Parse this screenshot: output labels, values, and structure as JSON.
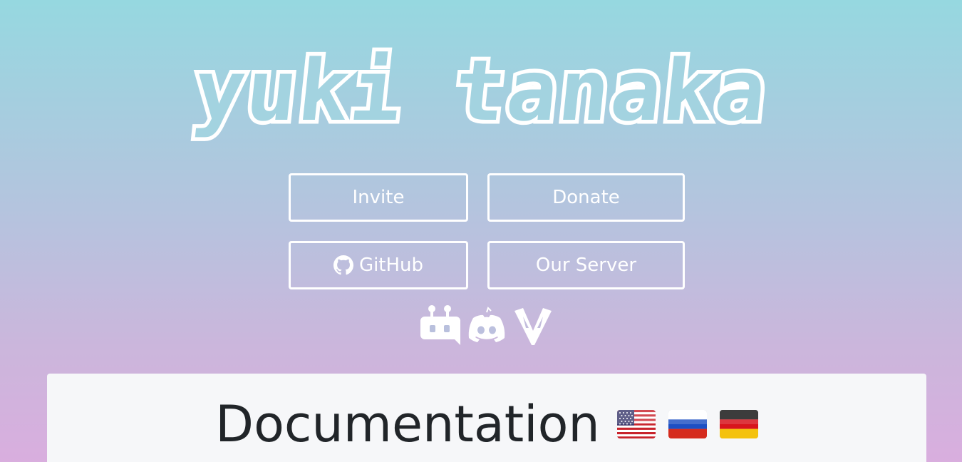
{
  "header": {
    "logo_text": "yuki tanaka"
  },
  "buttons": {
    "invite": "Invite",
    "donate": "Donate",
    "github": "GitHub",
    "server": "Our Server"
  },
  "icons": {
    "github": "github-icon",
    "bot_list": "robot-icon",
    "discord": "discord-icon",
    "v_logo": "v-wings-icon"
  },
  "documentation": {
    "title": "Documentation",
    "languages": [
      {
        "code": "en",
        "flag": "us-flag-icon"
      },
      {
        "code": "ru",
        "flag": "russia-flag-icon"
      },
      {
        "code": "de",
        "flag": "germany-flag-icon"
      }
    ]
  },
  "colors": {
    "gradient_top": "#96d8e0",
    "gradient_bottom": "#d9aede",
    "button_border": "#ffffff",
    "panel_bg": "#f6f7f9",
    "title_text": "#212529"
  }
}
